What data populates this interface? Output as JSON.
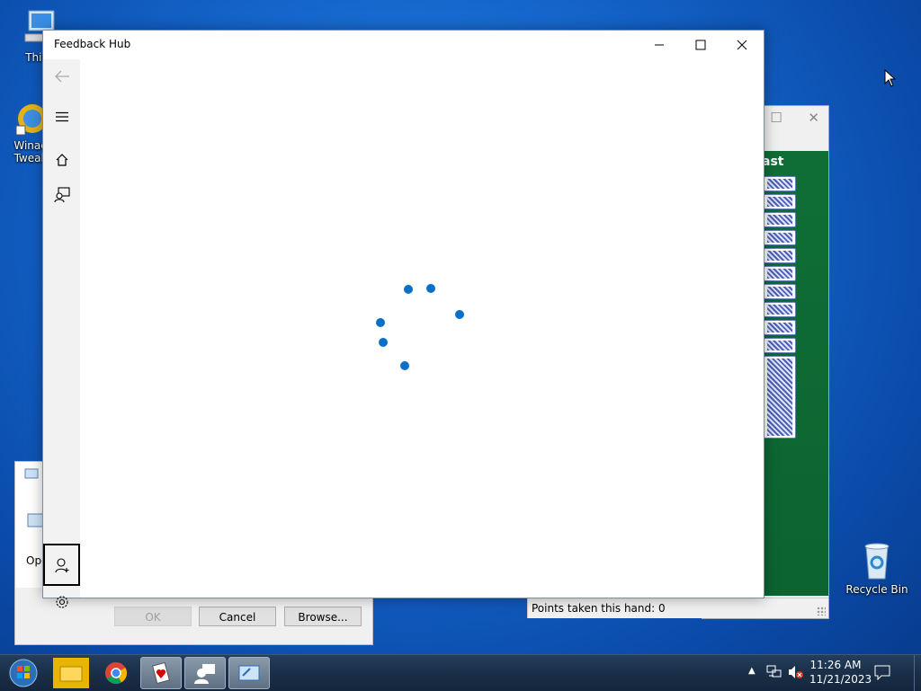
{
  "desktop": {
    "icons": [
      {
        "label": "This P"
      },
      {
        "label": "Winae"
      },
      {
        "label": "Tweak"
      },
      {
        "label": "Recycle Bin"
      }
    ]
  },
  "feedback_hub": {
    "title": "Feedback Hub",
    "accent": "#0a6fc7",
    "nav": [
      "back-icon",
      "hamburger-menu-icon",
      "home-icon",
      "feedback-icon",
      "add-account-icon",
      "settings-icon"
    ]
  },
  "hearts": {
    "player_label": "ast",
    "status_text": "Points taken this hand: 0",
    "felt_color": "#0f6e36"
  },
  "run_dialog": {
    "open_label": "Ope",
    "ok_label": "OK",
    "cancel_label": "Cancel",
    "browse_label": "Browse..."
  },
  "taskbar": {
    "time": "11:26 AM",
    "date": "11/21/2023",
    "apps": [
      "start-orb-icon",
      "file-explorer-icon",
      "chrome-icon",
      "hearts-app-icon",
      "feedback-hub-app-icon",
      "run-app-icon"
    ]
  }
}
